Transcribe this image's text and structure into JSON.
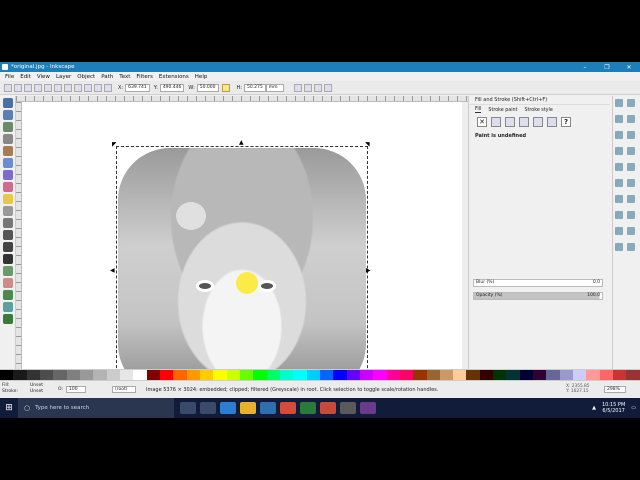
{
  "window": {
    "title": "*original.jpg - Inkscape",
    "controls": [
      "–",
      "❐",
      "✕"
    ]
  },
  "menu": [
    "File",
    "Edit",
    "View",
    "Layer",
    "Object",
    "Path",
    "Text",
    "Filters",
    "Extensions",
    "Help"
  ],
  "toolbar": {
    "x_label": "X:",
    "x_value": "639.741",
    "y_label": "Y:",
    "y_value": "490.446",
    "w_label": "W:",
    "w_value": "50.000",
    "h_label": "H:",
    "h_value": "50.275",
    "unit": "mm"
  },
  "fill_stroke_panel": {
    "header": "Fill and Stroke (Shift+Ctrl+F)",
    "tabs": [
      "Fill",
      "Stroke paint",
      "Stroke style"
    ],
    "paint_status": "Paint is undefined",
    "blur_label": "Blur (%)",
    "blur_value": "0.0",
    "opacity_label": "Opacity (%)",
    "opacity_value": "100.0"
  },
  "statusbar": {
    "fill_label": "Fill:",
    "stroke_label": "Stroke:",
    "fill_value": "Unset",
    "stroke_value": "Unset",
    "opacity_label": "O:",
    "opacity_value": "100",
    "layer": "(root)",
    "message": "Image 5376 × 3024: embedded; clipped; filtered (Greyscale) in root. Click selection to toggle scale/rotation handles.",
    "x_coord": "X: 2355.85",
    "y_coord": "Y: 1627.15",
    "zoom": "298%"
  },
  "palette_colors": [
    "#000000",
    "#1a1a1a",
    "#333333",
    "#4d4d4d",
    "#666666",
    "#808080",
    "#999999",
    "#b3b3b3",
    "#cccccc",
    "#e6e6e6",
    "#ffffff",
    "#800000",
    "#ff0000",
    "#ff6600",
    "#ff9900",
    "#ffcc00",
    "#ffff00",
    "#ccff00",
    "#66ff00",
    "#00ff00",
    "#00ff66",
    "#00ffcc",
    "#00ffff",
    "#00ccff",
    "#0066ff",
    "#0000ff",
    "#6600ff",
    "#cc00ff",
    "#ff00ff",
    "#ff0099",
    "#ff0066",
    "#993300",
    "#996633",
    "#cc9966",
    "#ffcc99",
    "#663300",
    "#330000",
    "#003300",
    "#003333",
    "#000033",
    "#330033",
    "#666699",
    "#9999cc",
    "#ccccff",
    "#ff9999",
    "#ff6666",
    "#cc3333",
    "#993333"
  ],
  "taskbar": {
    "search_placeholder": "Type here to search",
    "time": "10:15 PM",
    "date": "6/5/2017"
  }
}
